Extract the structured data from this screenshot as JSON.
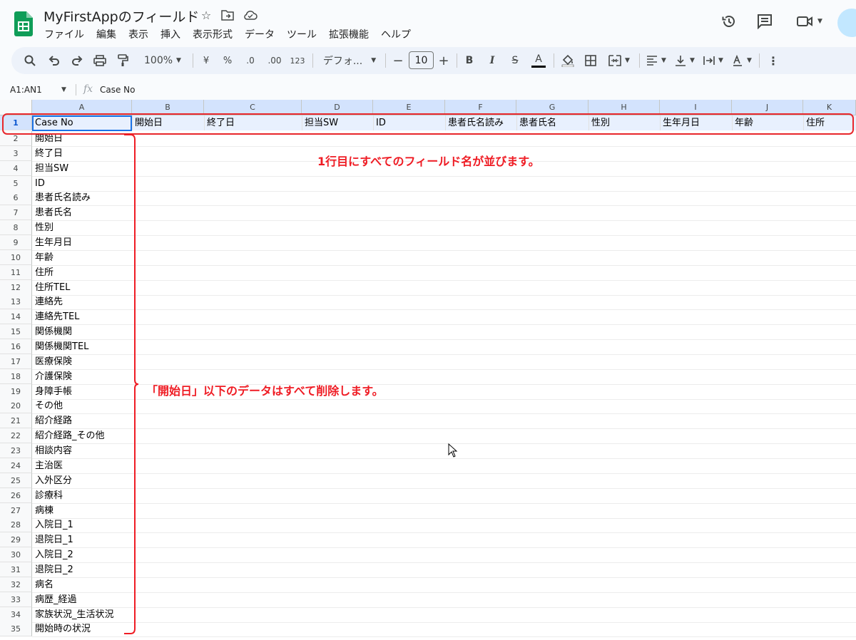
{
  "app": {
    "doc_title": "MyFirstAppのフィールド",
    "menu": [
      "ファイル",
      "編集",
      "表示",
      "挿入",
      "表示形式",
      "データ",
      "ツール",
      "拡張機能",
      "ヘルプ"
    ],
    "icons": {
      "star": "star-icon",
      "move": "move-to-folder-icon",
      "cloud": "cloud-saved-icon",
      "history": "version-history-icon",
      "comments": "comments-icon",
      "meet": "video-call-icon"
    }
  },
  "toolbar": {
    "zoom": "100%",
    "currency": "¥",
    "percent": "%",
    "decrease_decimal": ".0",
    "increase_decimal": ".00",
    "number_format": "123",
    "font_name": "デフォ...",
    "font_size": "10",
    "minus": "−",
    "plus": "+",
    "bold": "B",
    "italic": "I",
    "strike": "S",
    "text_color": "A",
    "text_color_bar": "#000000",
    "more": "⋮"
  },
  "formula_bar": {
    "name_box": "A1:AN1",
    "fx": "fx",
    "value": "Case No"
  },
  "grid": {
    "columns": [
      "A",
      "B",
      "C",
      "D",
      "E",
      "F",
      "G",
      "H",
      "I",
      "J",
      "K"
    ],
    "row1": [
      "Case No",
      "開始日",
      "終了日",
      "担当SW",
      "ID",
      "患者氏名読み",
      "患者氏名",
      "性別",
      "生年月日",
      "年齢",
      "住所"
    ],
    "rows": [
      {
        "n": "2",
        "a": "開始日"
      },
      {
        "n": "3",
        "a": "終了日"
      },
      {
        "n": "4",
        "a": "担当SW"
      },
      {
        "n": "5",
        "a": "ID"
      },
      {
        "n": "6",
        "a": "患者氏名読み"
      },
      {
        "n": "7",
        "a": "患者氏名"
      },
      {
        "n": "8",
        "a": "性別"
      },
      {
        "n": "9",
        "a": "生年月日"
      },
      {
        "n": "10",
        "a": "年齢"
      },
      {
        "n": "11",
        "a": "住所"
      },
      {
        "n": "12",
        "a": "住所TEL"
      },
      {
        "n": "13",
        "a": "連絡先"
      },
      {
        "n": "14",
        "a": "連絡先TEL"
      },
      {
        "n": "15",
        "a": "関係機関"
      },
      {
        "n": "16",
        "a": "関係機関TEL"
      },
      {
        "n": "17",
        "a": "医療保険"
      },
      {
        "n": "18",
        "a": "介護保険"
      },
      {
        "n": "19",
        "a": "身障手帳"
      },
      {
        "n": "20",
        "a": "その他"
      },
      {
        "n": "21",
        "a": "紹介経路"
      },
      {
        "n": "22",
        "a": "紹介経路_その他"
      },
      {
        "n": "23",
        "a": "相談内容"
      },
      {
        "n": "24",
        "a": "主治医"
      },
      {
        "n": "25",
        "a": "入外区分"
      },
      {
        "n": "26",
        "a": "診療科"
      },
      {
        "n": "27",
        "a": "病棟"
      },
      {
        "n": "28",
        "a": "入院日_1"
      },
      {
        "n": "29",
        "a": "退院日_1"
      },
      {
        "n": "30",
        "a": "入院日_2"
      },
      {
        "n": "31",
        "a": "退院日_2"
      },
      {
        "n": "32",
        "a": "病名"
      },
      {
        "n": "33",
        "a": "病歴_経過"
      },
      {
        "n": "34",
        "a": "家族状況_生活状況"
      },
      {
        "n": "35",
        "a": "開始時の状況"
      }
    ],
    "row1_number": "1"
  },
  "annotations": {
    "row1_note": "1行目にすべてのフィールド名が並びます。",
    "delete_note": "「開始日」以下のデータはすべて削除します。",
    "color": "#ef1c24"
  }
}
